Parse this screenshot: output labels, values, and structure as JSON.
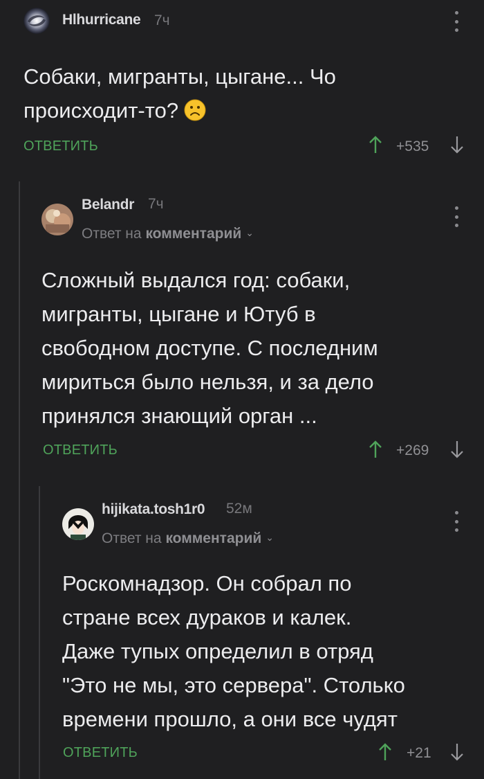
{
  "comments": [
    {
      "author": "Hlhurricane",
      "time": "7ч",
      "text": "Собаки, мигранты, цыгане... Чо\nпроисходит-то?",
      "emoji": "frowning-face",
      "reply_label": "ОТВЕТИТЬ",
      "rating": "+535"
    },
    {
      "author": "Belandr",
      "time": "7ч",
      "reply_to_prefix": "Ответ на",
      "reply_to_target": "комментарий",
      "text": "Сложный выдался год: собаки,\nмигранты, цыгане и Ютуб в\nсвободном доступе. С последним\nмириться было нельзя, и за дело\nпринялся знающий орган ...",
      "reply_label": "ОТВЕТИТЬ",
      "rating": "+269"
    },
    {
      "author": "hijikata.tosh1r0",
      "time": "52м",
      "reply_to_prefix": "Ответ на",
      "reply_to_target": "комментарий",
      "text": "Роскомнадзор. Он собрал по\nстране всех дураков и калек.\nДаже тупых определил в отряд\n\"Это не мы, это сервера\". Столько\nвремени прошло, а они все чудят",
      "reply_label": "ОТВЕТИТЬ",
      "rating": "+21"
    }
  ],
  "colors": {
    "background": "#1f1f21",
    "reply_green": "#4fa35a",
    "upvote_green": "#4fa35a",
    "thread_line": "#3a3a3d"
  }
}
